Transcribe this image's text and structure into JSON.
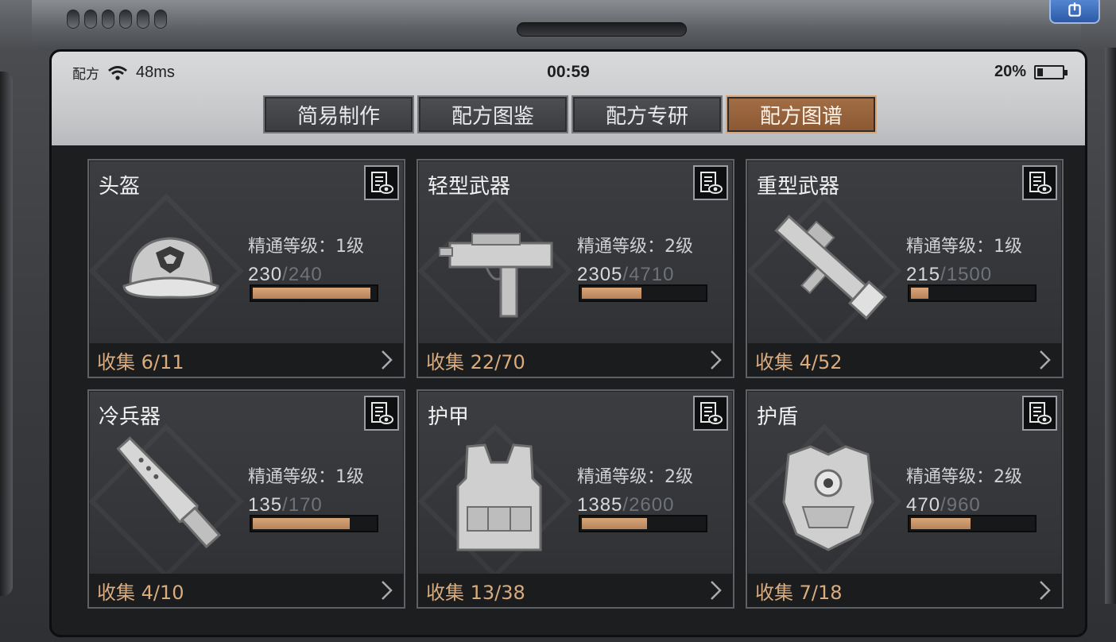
{
  "status": {
    "carrier": "配方",
    "latency": "48ms",
    "time": "00:59",
    "battery": "20%",
    "battery_level": 0.2
  },
  "tabs": [
    {
      "label": "简易制作",
      "active": false
    },
    {
      "label": "配方图鉴",
      "active": false
    },
    {
      "label": "配方专研",
      "active": false
    },
    {
      "label": "配方图谱",
      "active": true
    }
  ],
  "cards": [
    {
      "title": "头盔",
      "mastery": "精通等级：1级",
      "current": "230",
      "max": "240",
      "progress": 0.958,
      "collect": "收集 6/11",
      "icon": "helmet-icon"
    },
    {
      "title": "轻型武器",
      "mastery": "精通等级：2级",
      "current": "2305",
      "max": "4710",
      "progress": 0.489,
      "collect": "收集 22/70",
      "icon": "smg-icon"
    },
    {
      "title": "重型武器",
      "mastery": "精通等级：1级",
      "current": "215",
      "max": "1500",
      "progress": 0.143,
      "collect": "收集 4/52",
      "icon": "rocket-launcher-icon"
    },
    {
      "title": "冷兵器",
      "mastery": "精通等级：1级",
      "current": "135",
      "max": "170",
      "progress": 0.794,
      "collect": "收集 4/10",
      "icon": "blade-icon"
    },
    {
      "title": "护甲",
      "mastery": "精通等级：2级",
      "current": "1385",
      "max": "2600",
      "progress": 0.533,
      "collect": "收集 13/38",
      "icon": "vest-icon"
    },
    {
      "title": "护盾",
      "mastery": "精通等级：2级",
      "current": "470",
      "max": "960",
      "progress": 0.49,
      "collect": "收集 7/18",
      "icon": "shield-armor-icon"
    }
  ],
  "colors": {
    "accent": "#d9a67a",
    "tab_active": "#9b6740"
  }
}
